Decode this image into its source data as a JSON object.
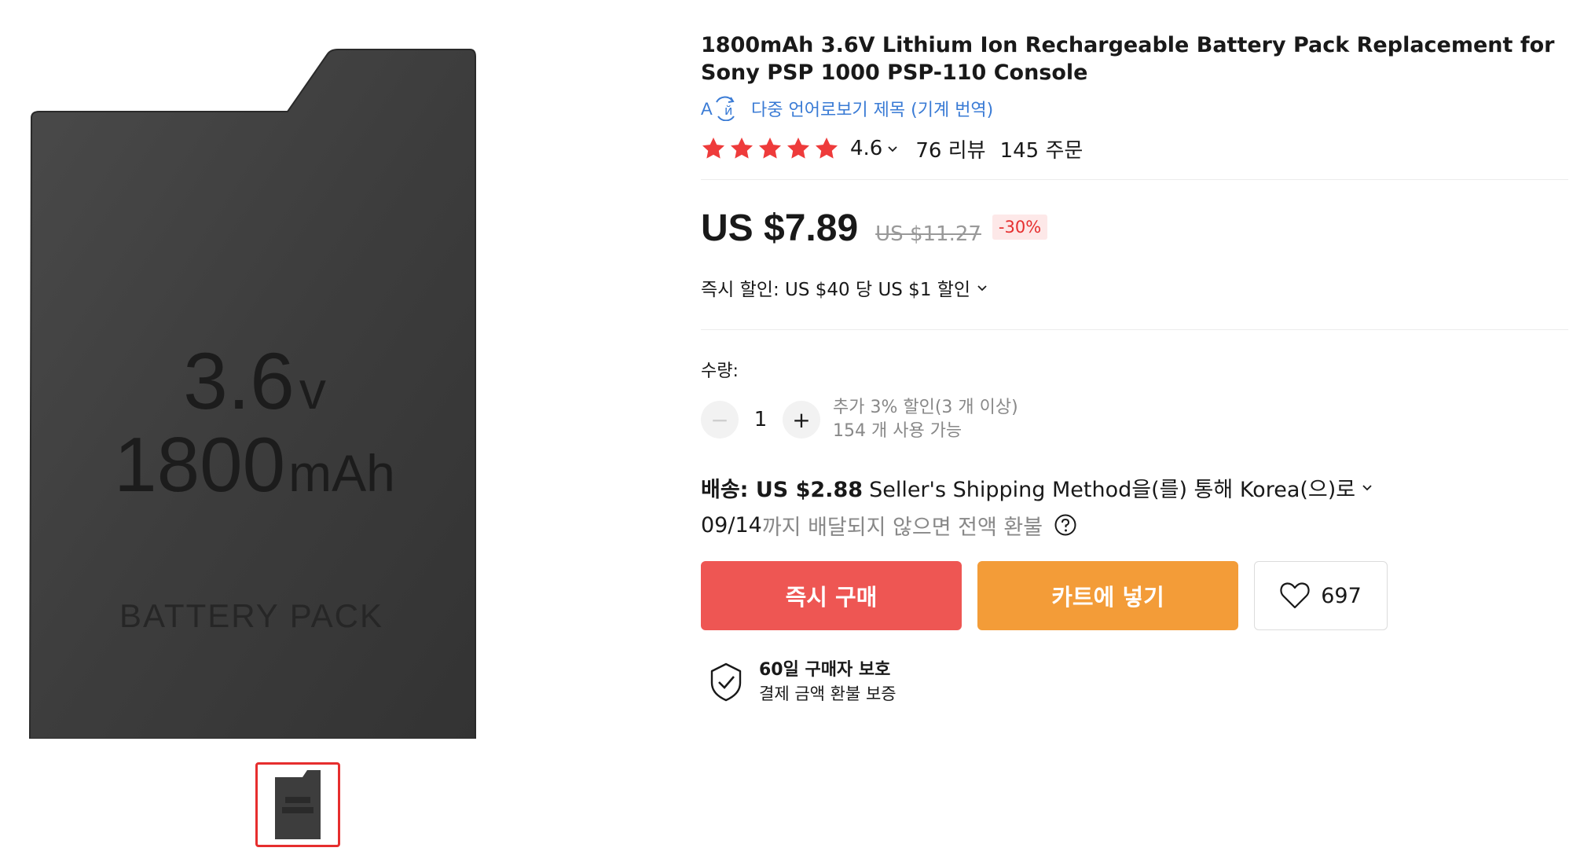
{
  "product": {
    "title": "1800mAh 3.6V Lithium Ion Rechargeable Battery Pack Replacement for Sony PSP 1000 PSP-110 Console",
    "image": {
      "voltage_text": "3.6",
      "voltage_unit": "v",
      "capacity_text": "1800",
      "capacity_unit": "mAh",
      "label_text": "BATTERY PACK"
    }
  },
  "translate": {
    "icon": "translate-icon",
    "label": "다중 언어로보기 제목 (기계 번역)"
  },
  "rating": {
    "stars": 5,
    "value": "4.6",
    "reviews": "76 리뷰",
    "orders": "145 주문"
  },
  "price": {
    "current": "US $7.89",
    "original": "US $11.27",
    "discount": "-30%"
  },
  "instant_discount": "즉시 할인: US $40 당 US $1 할인",
  "quantity": {
    "label": "수량:",
    "value": "1",
    "minus": "−",
    "plus": "+",
    "bulk_discount": "추가 3% 할인(3 개 이상)",
    "available": "154 개 사용 가능"
  },
  "shipping": {
    "label": "배송: US $2.88",
    "method": "Seller's Shipping Method을(를) 통해 Korea(으)로",
    "delivery_date": "09/14",
    "delivery_text": "까지 배달되지 않으면 전액 환불"
  },
  "buttons": {
    "buy": "즉시 구매",
    "cart": "카트에 넣기",
    "wishlist_count": "697"
  },
  "protection": {
    "title": "60일 구매자 보호",
    "subtitle": "결제 금액 환불 보증"
  },
  "colors": {
    "buy": "#ee5653",
    "cart": "#f39c38",
    "star": "#ee3b3b",
    "link": "#3a7bd5",
    "discount": "#e62e2e"
  }
}
